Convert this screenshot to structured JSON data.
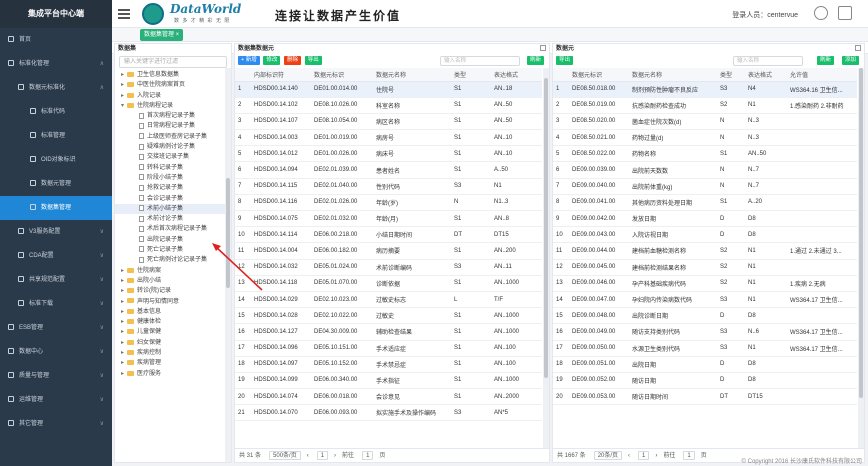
{
  "app": {
    "brand": "集成平台中心端"
  },
  "sidebar": {
    "items": [
      {
        "label": "首页",
        "level": 0,
        "active": false,
        "arrow": ""
      },
      {
        "label": "标准化管理",
        "level": 0,
        "active": false,
        "arrow": "∧"
      },
      {
        "label": "数据元标准化",
        "level": 1,
        "active": false,
        "arrow": "∧"
      },
      {
        "label": "标准代码",
        "level": 2,
        "active": false,
        "arrow": ""
      },
      {
        "label": "标准管理",
        "level": 2,
        "active": false,
        "arrow": ""
      },
      {
        "label": "OID对象标识",
        "level": 2,
        "active": false,
        "arrow": ""
      },
      {
        "label": "数据元管理",
        "level": 2,
        "active": false,
        "arrow": ""
      },
      {
        "label": "数据集管理",
        "level": 2,
        "active": true,
        "arrow": ""
      },
      {
        "label": "V3服务配置",
        "level": 1,
        "active": false,
        "arrow": "∨"
      },
      {
        "label": "CDA配置",
        "level": 1,
        "active": false,
        "arrow": "∨"
      },
      {
        "label": "共享规范配置",
        "level": 1,
        "active": false,
        "arrow": "∨"
      },
      {
        "label": "标准下载",
        "level": 1,
        "active": false,
        "arrow": "∨"
      },
      {
        "label": "ESB管理",
        "level": 0,
        "active": false,
        "arrow": "∨"
      },
      {
        "label": "数据中心",
        "level": 0,
        "active": false,
        "arrow": "∨"
      },
      {
        "label": "质量与管理",
        "level": 0,
        "active": false,
        "arrow": "∨"
      },
      {
        "label": "运维管理",
        "level": 0,
        "active": false,
        "arrow": "∨"
      },
      {
        "label": "其它管理",
        "level": 0,
        "active": false,
        "arrow": "∨"
      }
    ]
  },
  "header": {
    "logo_text": "DataWorld",
    "logo_sub": "数 多 才 精 彩 无 限",
    "slogan": "连接让数据产生价值",
    "user_label": "登录人员：",
    "user_name": "centervue"
  },
  "tabs": {
    "home": "首页",
    "current": "数据集管理 ×"
  },
  "tree": {
    "title": "数据集",
    "search_placeholder": "输入关键字进行过滤",
    "rows": [
      {
        "label": "卫生信息数据集",
        "type": "folder",
        "indent": 1,
        "twisty": "▸",
        "sel": false
      },
      {
        "label": "中医住院病案首页",
        "type": "folder",
        "indent": 1,
        "twisty": "▸",
        "sel": false
      },
      {
        "label": "入院记录",
        "type": "folder",
        "indent": 1,
        "twisty": "▸",
        "sel": false
      },
      {
        "label": "住院病程记录",
        "type": "folder",
        "indent": 1,
        "twisty": "▾",
        "sel": false
      },
      {
        "label": "首次病程记录子集",
        "type": "file",
        "indent": 2,
        "twisty": "",
        "sel": false
      },
      {
        "label": "日常病程记录子集",
        "type": "file",
        "indent": 2,
        "twisty": "",
        "sel": false
      },
      {
        "label": "上级医师查房记录子集",
        "type": "file",
        "indent": 2,
        "twisty": "",
        "sel": false
      },
      {
        "label": "疑难病例讨论子集",
        "type": "file",
        "indent": 2,
        "twisty": "",
        "sel": false
      },
      {
        "label": "交接班记录子集",
        "type": "file",
        "indent": 2,
        "twisty": "",
        "sel": false
      },
      {
        "label": "转科记录子集",
        "type": "file",
        "indent": 2,
        "twisty": "",
        "sel": false
      },
      {
        "label": "阶段小结子集",
        "type": "file",
        "indent": 2,
        "twisty": "",
        "sel": false
      },
      {
        "label": "抢救记录子集",
        "type": "file",
        "indent": 2,
        "twisty": "",
        "sel": false
      },
      {
        "label": "会诊记录子集",
        "type": "file",
        "indent": 2,
        "twisty": "",
        "sel": false
      },
      {
        "label": "术前小结子集",
        "type": "file",
        "indent": 2,
        "twisty": "",
        "sel": true
      },
      {
        "label": "术前讨论子集",
        "type": "file",
        "indent": 2,
        "twisty": "",
        "sel": false
      },
      {
        "label": "术后首次病程记录子集",
        "type": "file",
        "indent": 2,
        "twisty": "",
        "sel": false
      },
      {
        "label": "出院记录子集",
        "type": "file",
        "indent": 2,
        "twisty": "",
        "sel": false
      },
      {
        "label": "死亡记录子集",
        "type": "file",
        "indent": 2,
        "twisty": "",
        "sel": false
      },
      {
        "label": "死亡病例讨论记录子集",
        "type": "file",
        "indent": 2,
        "twisty": "",
        "sel": false
      },
      {
        "label": "住院病案",
        "type": "folder",
        "indent": 1,
        "twisty": "▸",
        "sel": false
      },
      {
        "label": "出院小结",
        "type": "folder",
        "indent": 1,
        "twisty": "▸",
        "sel": false
      },
      {
        "label": "转诊(院)记录",
        "type": "folder",
        "indent": 1,
        "twisty": "▸",
        "sel": false
      },
      {
        "label": "声明与知情同意",
        "type": "folder",
        "indent": 1,
        "twisty": "▸",
        "sel": false
      },
      {
        "label": "基本信息",
        "type": "folder",
        "indent": 1,
        "twisty": "▸",
        "sel": false
      },
      {
        "label": "健康体检",
        "type": "folder",
        "indent": 1,
        "twisty": "▸",
        "sel": false
      },
      {
        "label": "儿童保健",
        "type": "folder",
        "indent": 1,
        "twisty": "▸",
        "sel": false
      },
      {
        "label": "妇女保健",
        "type": "folder",
        "indent": 1,
        "twisty": "▸",
        "sel": false
      },
      {
        "label": "疾病控制",
        "type": "folder",
        "indent": 1,
        "twisty": "▸",
        "sel": false
      },
      {
        "label": "疾病管理",
        "type": "folder",
        "indent": 1,
        "twisty": "▸",
        "sel": false
      },
      {
        "label": "医疗服务",
        "type": "folder",
        "indent": 1,
        "twisty": "▸",
        "sel": false
      }
    ]
  },
  "mid": {
    "title": "数据集数据元",
    "btn_add": "+ 新增",
    "btn_edit": "修改",
    "btn_del": "删除",
    "btn_export": "导出",
    "search_placeholder": "输入名称",
    "btn_refresh": "刷新",
    "columns": [
      "",
      "内部标识符",
      "数据元标识",
      "数据元名称",
      "类型",
      "表达格式"
    ],
    "rows": [
      [
        "1",
        "HDSD00.14.140",
        "DE01.00.014.00",
        "住院号",
        "S1",
        "AN..18"
      ],
      [
        "2",
        "HDSD00.14.102",
        "DE08.10.026.00",
        "科室名称",
        "S1",
        "AN..50"
      ],
      [
        "3",
        "HDSD00.14.107",
        "DE08.10.054.00",
        "病区名称",
        "S1",
        "AN..50"
      ],
      [
        "4",
        "HDSD00.14.003",
        "DE01.00.019.00",
        "病房号",
        "S1",
        "AN..10"
      ],
      [
        "5",
        "HDSD00.14.012",
        "DE01.00.026.00",
        "病床号",
        "S1",
        "AN..10"
      ],
      [
        "6",
        "HDSD00.14.094",
        "DE02.01.039.00",
        "患者姓名",
        "S1",
        "A..50"
      ],
      [
        "7",
        "HDSD00.14.115",
        "DE02.01.040.00",
        "性别代码",
        "S3",
        "N1"
      ],
      [
        "8",
        "HDSD00.14.116",
        "DE02.01.026.00",
        "年龄(岁)",
        "N",
        "N1..3"
      ],
      [
        "9",
        "HDSD00.14.075",
        "DE02.01.032.00",
        "年龄(月)",
        "S1",
        "AN..8"
      ],
      [
        "10",
        "HDSD00.14.114",
        "DE06.00.218.00",
        "小结日期时间",
        "DT",
        "DT15"
      ],
      [
        "11",
        "HDSD00.14.004",
        "DE06.00.182.00",
        "病历摘要",
        "S1",
        "AN..200"
      ],
      [
        "12",
        "HDSD00.14.032",
        "DE05.01.024.00",
        "术前诊断编码",
        "S3",
        "AN..11"
      ],
      [
        "13",
        "HDSD00.14.118",
        "DE05.01.070.00",
        "诊断依据",
        "S1",
        "AN..1000"
      ],
      [
        "14",
        "HDSD00.14.029",
        "DE02.10.023.00",
        "过敏史标志",
        "L",
        "T/F"
      ],
      [
        "15",
        "HDSD00.14.028",
        "DE02.10.022.00",
        "过敏史",
        "S1",
        "AN..1000"
      ],
      [
        "16",
        "HDSD00.14.127",
        "DE04.30.009.00",
        "辅助检查结果",
        "S1",
        "AN..1000"
      ],
      [
        "17",
        "HDSD00.14.096",
        "DE05.10.151.00",
        "手术适应症",
        "S1",
        "AN..100"
      ],
      [
        "18",
        "HDSD00.14.097",
        "DE05.10.152.00",
        "手术禁忌症",
        "S1",
        "AN..100"
      ],
      [
        "19",
        "HDSD00.14.099",
        "DE06.00.340.00",
        "手术指征",
        "S1",
        "AN..1000"
      ],
      [
        "20",
        "HDSD00.14.074",
        "DE06.00.018.00",
        "会诊意见",
        "S1",
        "AN..2000"
      ],
      [
        "21",
        "HDSD00.14.070",
        "DE06.00.093.00",
        "拟实施手术及操作编码",
        "S3",
        "AN*5"
      ]
    ],
    "pager": {
      "total": "共 31 条",
      "size": "500条/页",
      "prev": "‹",
      "page": "1",
      "next": "›",
      "goto_pre": "前往",
      "goto_val": "1",
      "goto_post": "页"
    }
  },
  "right": {
    "title": "数据元",
    "btn_export": "导出",
    "search_placeholder": "输入名称",
    "btn_refresh": "刷新",
    "btn_add": "添加",
    "columns": [
      "",
      "数据元标识",
      "数据元名称",
      "类型",
      "表达格式",
      "允许值"
    ],
    "rows": [
      [
        "1",
        "DE08.50.018.00",
        "制剂预防性肿瘤不良反应",
        "S3",
        "N4",
        "WS364.16 卫生信..."
      ],
      [
        "2",
        "DE08.50.019.00",
        "抗感染耐药检查成功",
        "S2",
        "N1",
        "1.感染耐药 2.非耐药"
      ],
      [
        "3",
        "DE08.50.020.00",
        "菌血症住院次数(d)",
        "N",
        "N..3",
        ""
      ],
      [
        "4",
        "DE08.50.021.00",
        "药物过量(d)",
        "N",
        "N..3",
        ""
      ],
      [
        "5",
        "DE08.50.022.00",
        "药物名称",
        "S1",
        "AN..50",
        ""
      ],
      [
        "6",
        "DE09.00.039.00",
        "出院前天数数",
        "N",
        "N..7",
        ""
      ],
      [
        "7",
        "DE09.00.040.00",
        "出院前体重(kg)",
        "N",
        "N..7",
        ""
      ],
      [
        "8",
        "DE09.00.041.00",
        "其他病历资料处理日期",
        "S1",
        "A..20",
        ""
      ],
      [
        "9",
        "DE09.00.042.00",
        "发放日期",
        "D",
        "D8",
        ""
      ],
      [
        "10",
        "DE09.00.043.00",
        "入院访视日期",
        "D",
        "D8",
        ""
      ],
      [
        "11",
        "DE09.00.044.00",
        "建档前血糖检测名称",
        "S2",
        "N1",
        "1.通过 2.未通过 3..."
      ],
      [
        "12",
        "DE09.00.045.00",
        "建档前检测结果名称",
        "S2",
        "N1",
        ""
      ],
      [
        "13",
        "DE09.00.046.00",
        "孕产科基础疾病代码",
        "S2",
        "N1",
        "1.疾病 2.无病"
      ],
      [
        "14",
        "DE09.00.047.00",
        "孕妇院内传染病数代码",
        "S3",
        "N1",
        "WS364.17 卫生信..."
      ],
      [
        "15",
        "DE09.00.048.00",
        "出院诊断日期",
        "D",
        "D8",
        ""
      ],
      [
        "16",
        "DE09.00.049.00",
        "随访支持类别代码",
        "S3",
        "N..6",
        "WS364.17 卫生信..."
      ],
      [
        "17",
        "DE09.00.050.00",
        "水源卫生类别代码",
        "S3",
        "N1",
        "WS364.17 卫生信..."
      ],
      [
        "18",
        "DE09.00.051.00",
        "出院日期",
        "D",
        "D8",
        ""
      ],
      [
        "19",
        "DE09.00.052.00",
        "随访日期",
        "D",
        "D8",
        ""
      ],
      [
        "20",
        "DE09.00.053.00",
        "随访日期时间",
        "DT",
        "DT15",
        ""
      ]
    ],
    "pager": {
      "total": "共 1667 条",
      "size": "20条/页",
      "prev": "‹",
      "page": "1",
      "next": "›",
      "goto_pre": "前往",
      "goto_val": "1",
      "goto_post": "页"
    }
  },
  "footer": "© Copyright 2016 长沙康氏软件科技有限公司"
}
